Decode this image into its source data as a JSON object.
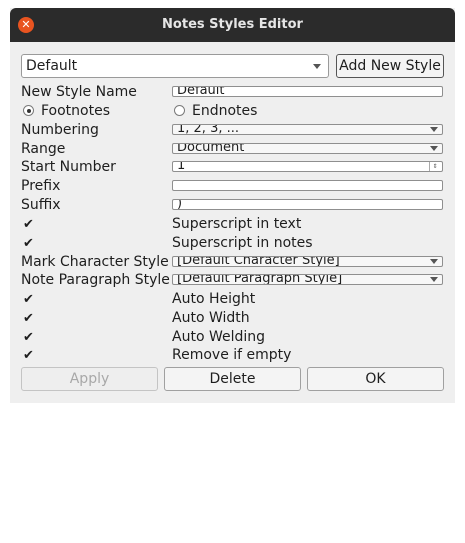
{
  "window": {
    "title": "Notes Styles Editor",
    "close_glyph": "✕"
  },
  "style_selector": {
    "selected": "Default"
  },
  "add_new_style_label": "Add New Style",
  "form": {
    "new_style_name_label": "New Style Name",
    "new_style_name_value": "Default",
    "footnotes_label": "Footnotes",
    "footnotes_selected": true,
    "endnotes_label": "Endnotes",
    "endnotes_selected": false,
    "numbering_label": "Numbering",
    "numbering_value": "1, 2, 3, ...",
    "range_label": "Range",
    "range_value": "Document",
    "start_number_label": "Start Number",
    "start_number_value": "1",
    "prefix_label": "Prefix",
    "prefix_value": "",
    "suffix_label": "Suffix",
    "suffix_value": ")",
    "superscript_text_label": "Superscript in text",
    "superscript_notes_label": "Superscript in notes",
    "check_glyph": "✔",
    "mark_char_style_label": "Mark Character Style",
    "mark_char_style_value": "[Default Character Style]",
    "note_para_style_label": "Note Paragraph Style",
    "note_para_style_value": "[Default Paragraph Style]",
    "auto_height_label": "Auto Height",
    "auto_width_label": "Auto Width",
    "auto_welding_label": "Auto Welding",
    "remove_if_empty_label": "Remove if empty"
  },
  "buttons": {
    "apply": "Apply",
    "delete": "Delete",
    "ok": "OK"
  },
  "colors": {
    "titlebar": "#2b2b2b",
    "close_button": "#e95420",
    "dialog_bg": "#efefef"
  }
}
